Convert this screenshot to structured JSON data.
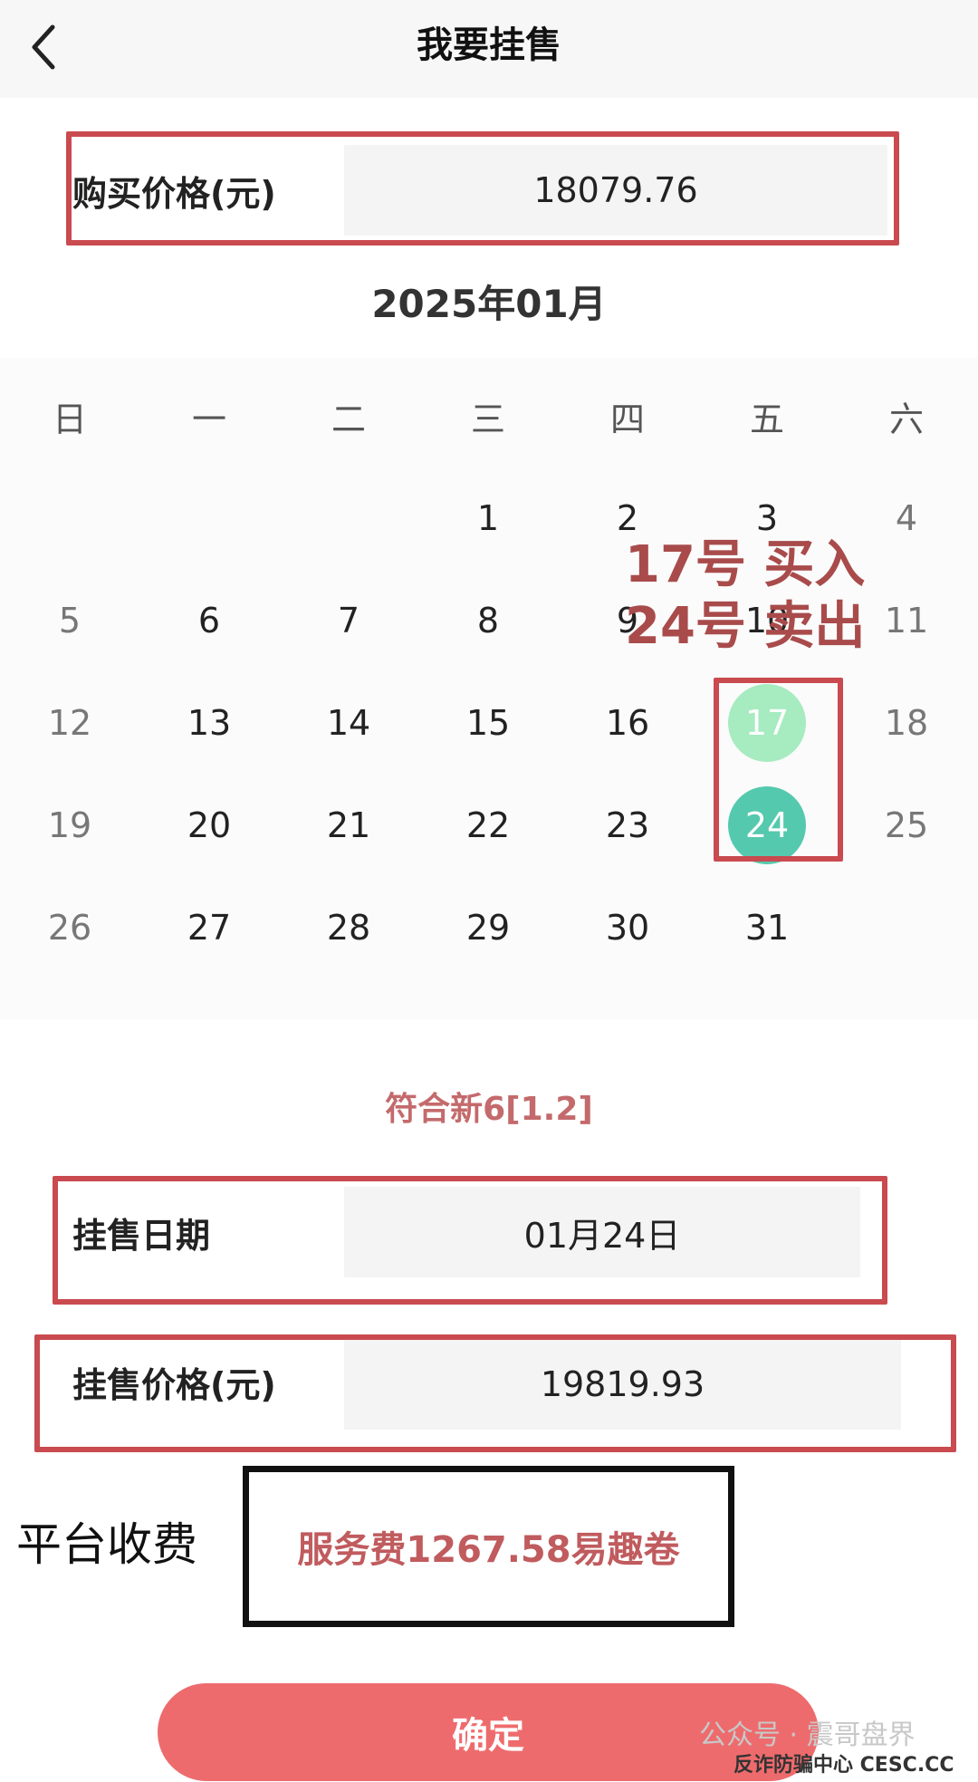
{
  "header": {
    "title": "我要挂售",
    "back_icon": "chevron-left-icon"
  },
  "purchase": {
    "label": "购买价格(元)",
    "value": "18079.76"
  },
  "calendar": {
    "month": "2025年01月",
    "weekdays": [
      "日",
      "一",
      "二",
      "三",
      "四",
      "五",
      "六"
    ],
    "selected_buy": "17",
    "selected_sell": "24"
  },
  "annotation": {
    "line1": "17号 买入",
    "line2": "24号 卖出"
  },
  "rule_text": "符合新6[1.2]",
  "listing_date": {
    "label": "挂售日期",
    "value": "01月24日"
  },
  "listing_price": {
    "label": "挂售价格(元)",
    "value": "19819.93"
  },
  "fee": {
    "label": "平台收费",
    "text": "服务费1267.58易趣卷"
  },
  "confirm_label": "确定",
  "watermark": {
    "line1": "公众号 · 震哥盘界",
    "line2": "反诈防骗中心  CESC.CC"
  }
}
